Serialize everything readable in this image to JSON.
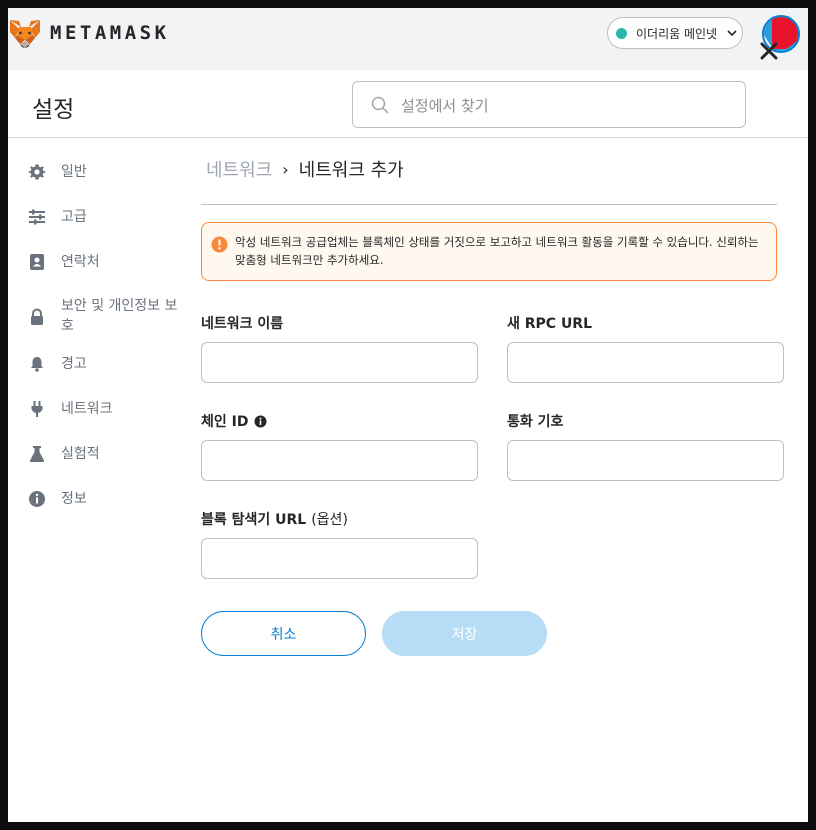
{
  "app": {
    "brand": "METAMASK",
    "network": {
      "label": "이더리움 메인넷",
      "dot_color": "#29b6af"
    }
  },
  "settings": {
    "title": "설정",
    "search": {
      "placeholder": "설정에서 찾기",
      "value": ""
    }
  },
  "sidebar": {
    "items": [
      {
        "label": "일반",
        "icon": "gear-icon"
      },
      {
        "label": "고급",
        "icon": "sliders-icon"
      },
      {
        "label": "연락처",
        "icon": "contact-book-icon"
      },
      {
        "label": "보안 및 개인정보 보호",
        "icon": "lock-icon"
      },
      {
        "label": "경고",
        "icon": "bell-icon"
      },
      {
        "label": "네트워크",
        "icon": "plug-icon"
      },
      {
        "label": "실험적",
        "icon": "flask-icon"
      },
      {
        "label": "정보",
        "icon": "info-icon"
      }
    ]
  },
  "breadcrumb": {
    "parent": "네트워크",
    "separator": "›",
    "current": "네트워크 추가"
  },
  "warning": {
    "text": "악성 네트워크 공급업체는 블록체인 상태를 거짓으로 보고하고 네트워크 활동을 기록할 수 있습니다. 신뢰하는 맞춤형 네트워크만 추가하세요."
  },
  "form": {
    "network_name": {
      "label": "네트워크 이름",
      "value": ""
    },
    "rpc_url": {
      "label": "새 RPC URL",
      "value": ""
    },
    "chain_id": {
      "label": "체인 ID",
      "value": ""
    },
    "currency_symbol": {
      "label": "통화 기호",
      "value": ""
    },
    "explorer_url": {
      "label": "블록 탐색기 URL",
      "optional": "(옵션)",
      "value": ""
    }
  },
  "buttons": {
    "cancel": "취소",
    "save": "저장"
  },
  "colors": {
    "accent": "#037dd6",
    "warning_border": "#f8883b",
    "warning_bg": "#fef8ef",
    "save_disabled": "#b6ddf5"
  }
}
